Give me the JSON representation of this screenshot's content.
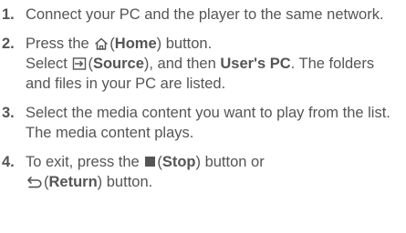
{
  "steps": [
    {
      "number": "1.",
      "text": "Connect your PC and the player to the same network."
    },
    {
      "number": "2.",
      "line1_prefix": "Press the",
      "home_icon": "home-icon",
      "home_open": "(",
      "home_label": "Home",
      "home_close": ") button.",
      "line2_prefix": "Select",
      "source_icon": "source-icon",
      "source_open": "(",
      "source_label": "Source",
      "source_close": "), and then",
      "users_pc": "User's PC",
      "line2_end": ". The folders and files in your PC are listed."
    },
    {
      "number": "3.",
      "text": "Select the media content you want to play from the list. The media content plays."
    },
    {
      "number": "4.",
      "prefix": "To exit, press the",
      "stop_icon": "stop-icon",
      "stop_open": "(",
      "stop_label": "Stop",
      "stop_close": ") button or",
      "return_icon": "return-icon",
      "return_open": "(",
      "return_label": "Return",
      "return_close": ") button."
    }
  ],
  "colors": {
    "text": "#555555",
    "background": "#ffffff"
  }
}
